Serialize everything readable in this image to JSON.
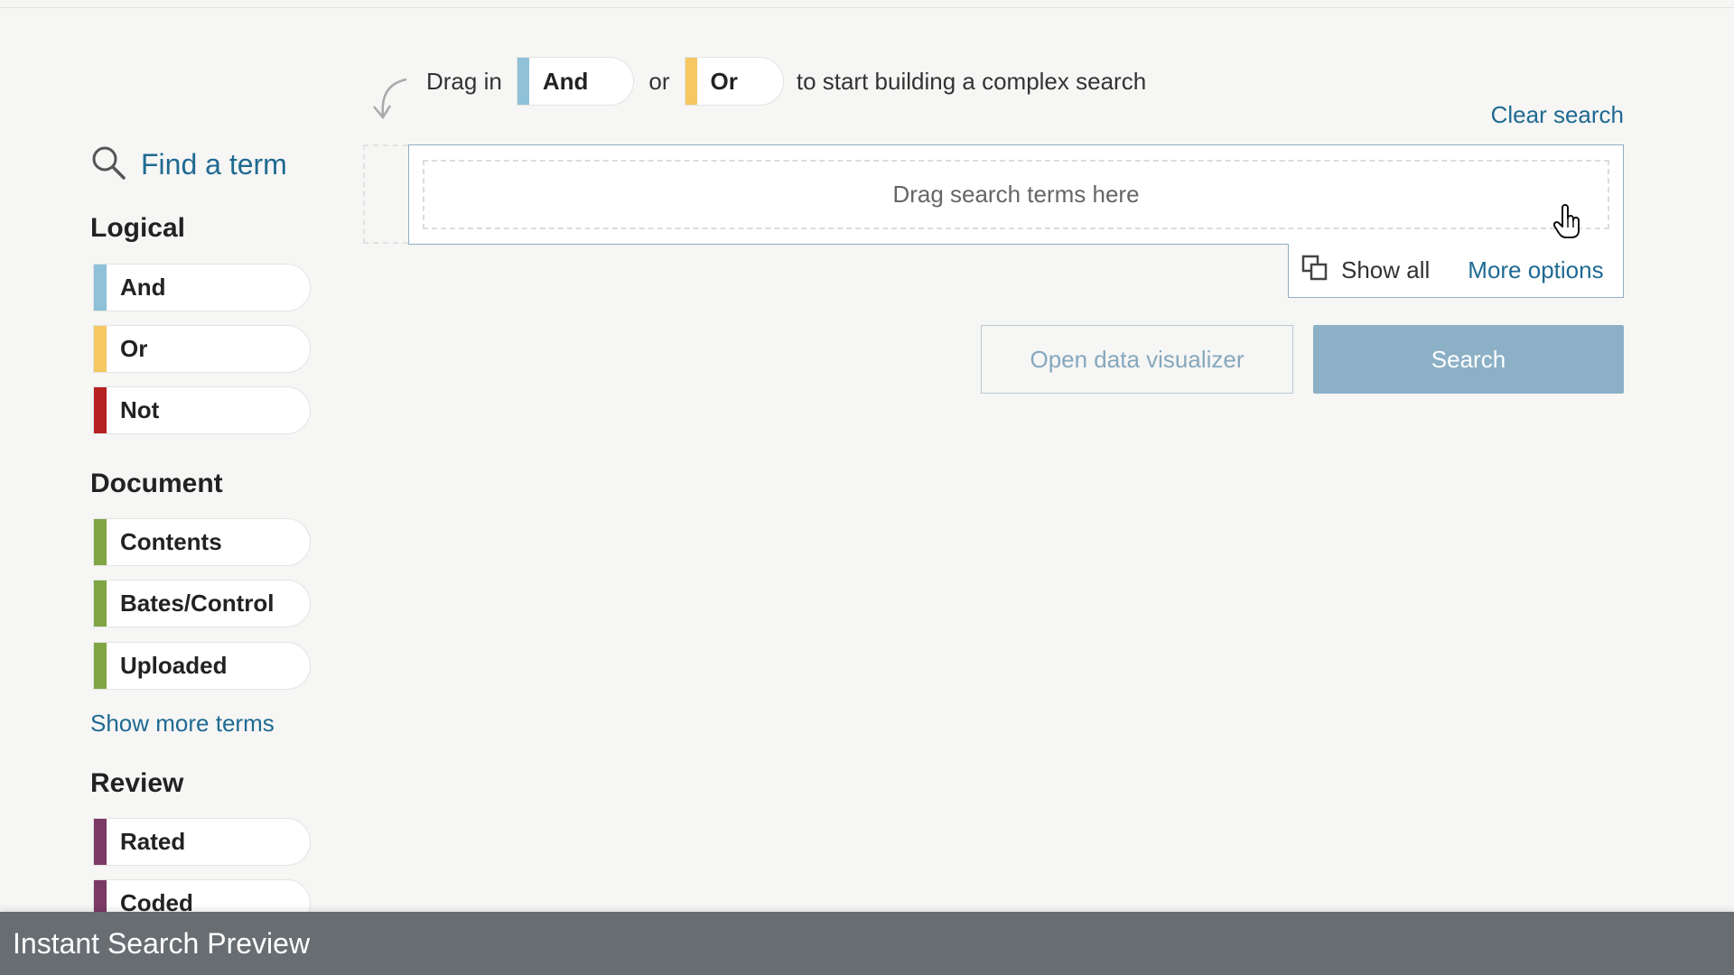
{
  "sidebar": {
    "find_term_label": "Find a term",
    "sections": [
      {
        "title": "Logical",
        "items": [
          {
            "label": "And",
            "color": "#8fc1d9"
          },
          {
            "label": "Or",
            "color": "#f5c862"
          },
          {
            "label": "Not",
            "color": "#b62222"
          }
        ]
      },
      {
        "title": "Document",
        "items": [
          {
            "label": "Contents",
            "color": "#7fa545"
          },
          {
            "label": "Bates/Control",
            "color": "#7fa545"
          },
          {
            "label": "Uploaded",
            "color": "#7fa545"
          }
        ]
      },
      {
        "title": "Review",
        "items": [
          {
            "label": "Rated",
            "color": "#7b3a64"
          },
          {
            "label": "Coded",
            "color": "#7b3a64"
          }
        ]
      }
    ],
    "show_more_label": "Show more terms"
  },
  "hint": {
    "prefix": "Drag in",
    "and_label": "And",
    "and_color": "#8fc1d9",
    "middle": "or",
    "or_label": "Or",
    "or_color": "#f5c862",
    "suffix": "to start building a complex search"
  },
  "clear_search_label": "Clear search",
  "drop_zone": {
    "placeholder": "Drag search terms here"
  },
  "options": {
    "show_all_label": "Show all",
    "more_options_label": "More options"
  },
  "buttons": {
    "visualizer_label": "Open data visualizer",
    "search_label": "Search"
  },
  "bottom_bar": {
    "title": "Instant Search Preview"
  },
  "icons": {
    "find": "search-icon",
    "hint_arrow": "curved-arrow-icon",
    "show_all": "show-all-icon",
    "cursor": "hand-pointer-icon"
  }
}
